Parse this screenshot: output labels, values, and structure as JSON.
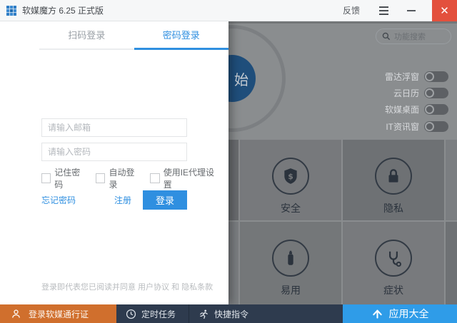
{
  "titlebar": {
    "title": "软媒魔方 6.25 正式版",
    "feedback": "反馈"
  },
  "icons": {
    "close": "✕"
  },
  "login_panel": {
    "tabs": [
      {
        "label": "扫码登录",
        "active": false
      },
      {
        "label": "密码登录",
        "active": true
      }
    ],
    "email_placeholder": "请输入邮箱",
    "password_placeholder": "请输入密码",
    "checkboxes": [
      "记住密码",
      "自动登录",
      "使用IE代理设置"
    ],
    "forgot_password": "忘记密码",
    "register": "注册",
    "login_button": "登录",
    "agreement_text": "登录即代表您已阅读并同意 用户协议 和 隐私条款"
  },
  "main": {
    "start_circle_label": "始",
    "search_placeholder": "功能搜索",
    "toggles": [
      {
        "label": "雷达浮窗",
        "on": false
      },
      {
        "label": "云日历",
        "on": false
      },
      {
        "label": "软媒桌面",
        "on": false
      },
      {
        "label": "IT资讯窗",
        "on": false
      }
    ],
    "tiles": [
      {
        "label": "安全",
        "icon": "shield-dollar-icon"
      },
      {
        "label": "隐私",
        "icon": "lock-icon"
      },
      {
        "label": "易用",
        "icon": "bottle-icon"
      },
      {
        "label": "症状",
        "icon": "stethoscope-icon"
      }
    ]
  },
  "bottom_bar": {
    "login_pass": "登录软媒通行证",
    "scheduled_tasks": "定时任务",
    "quick_commands": "快捷指令",
    "app_collection": "应用大全"
  },
  "colors": {
    "close_button": "#e3503d",
    "accent_blue": "#2f8fe0",
    "start_circle": "#1f4e7b",
    "overlay_gray": "#8a8d8f",
    "bar_orange": "#d06f2d",
    "bar_navy": "#2e3b4e",
    "bar_blue": "#2f9ce8"
  }
}
